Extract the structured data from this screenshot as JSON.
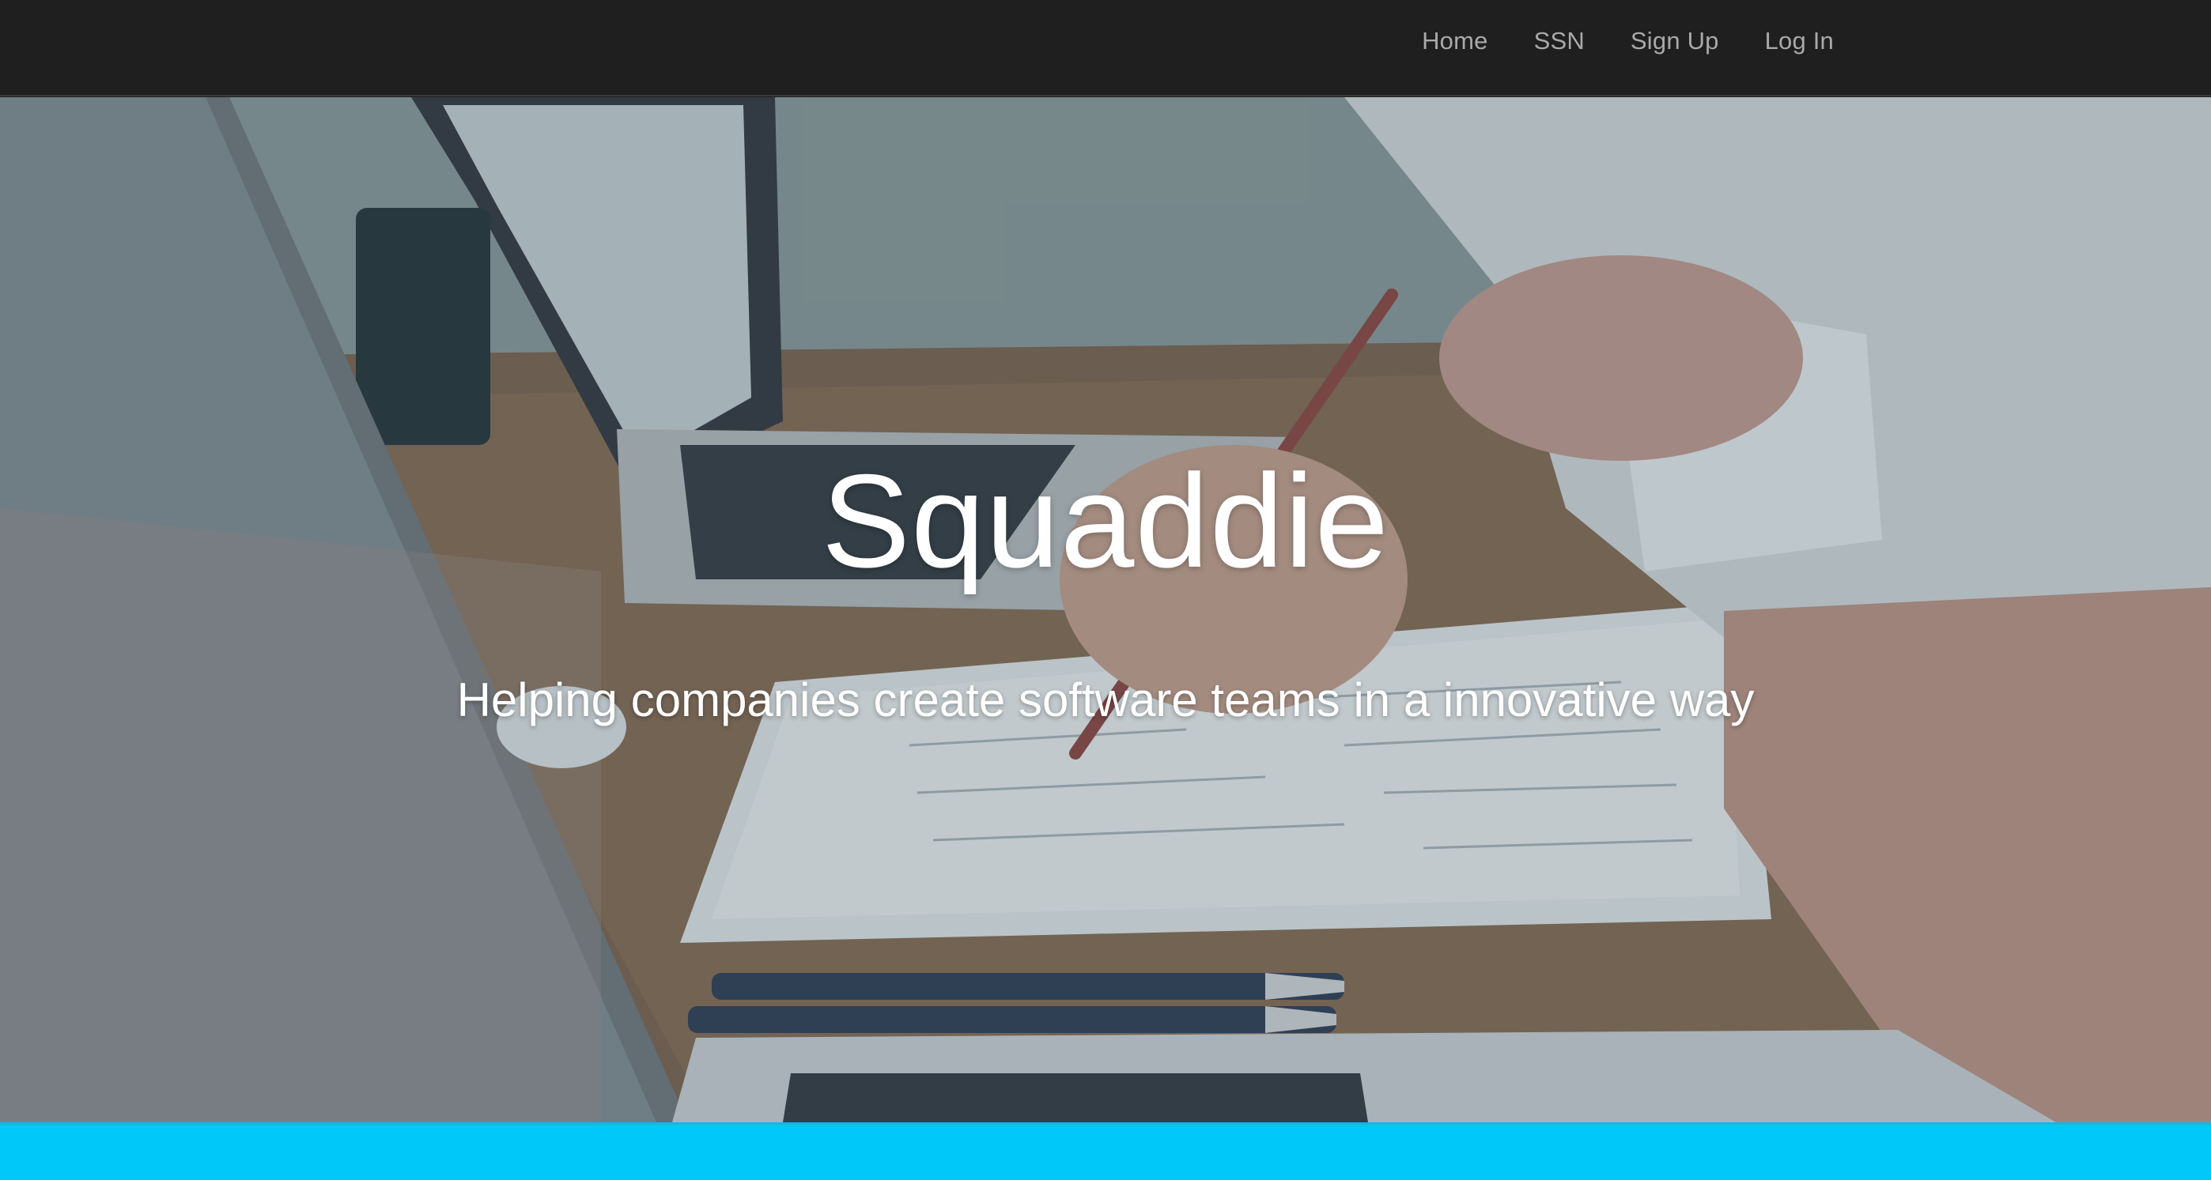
{
  "nav": {
    "items": [
      {
        "label": "Home"
      },
      {
        "label": "SSN"
      },
      {
        "label": "Sign Up"
      },
      {
        "label": "Log In"
      }
    ]
  },
  "hero": {
    "title": "Squaddie",
    "subtitle": "Helping companies create software teams in a innovative way",
    "background_image": "office-desk-laptops-photo"
  },
  "colors": {
    "navbar_bg": "#1f1f1f",
    "nav_link": "#a9a9a9",
    "footer_accent": "#00c8f8",
    "hero_text": "#ffffff"
  }
}
